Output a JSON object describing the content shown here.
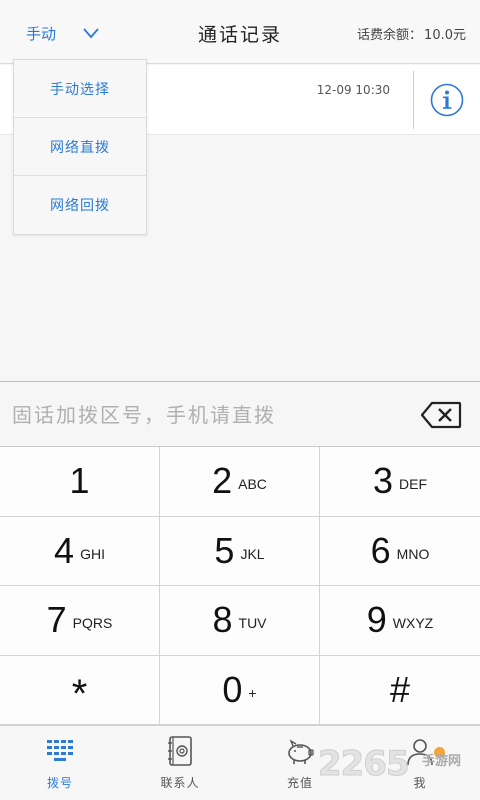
{
  "header": {
    "mode_label": "手动",
    "title": "通话记录",
    "balance_label": "话费余额：",
    "balance_value": "10.0元"
  },
  "call_log": [
    {
      "time": "12-09 10:30"
    }
  ],
  "mode_menu": {
    "options": [
      "手动选择",
      "网络直拨",
      "网络回拨"
    ]
  },
  "dialer": {
    "placeholder": "固话加拨区号，手机请直拨",
    "keys": [
      {
        "digit": "1",
        "letters": ""
      },
      {
        "digit": "2",
        "letters": "ABC"
      },
      {
        "digit": "3",
        "letters": "DEF"
      },
      {
        "digit": "4",
        "letters": "GHI"
      },
      {
        "digit": "5",
        "letters": "JKL"
      },
      {
        "digit": "6",
        "letters": "MNO"
      },
      {
        "digit": "7",
        "letters": "PQRS"
      },
      {
        "digit": "8",
        "letters": "TUV"
      },
      {
        "digit": "9",
        "letters": "WXYZ"
      },
      {
        "digit": "*",
        "letters": ""
      },
      {
        "digit": "0",
        "letters": "+"
      },
      {
        "digit": "#",
        "letters": ""
      }
    ]
  },
  "tabs": [
    {
      "label": "拨号",
      "icon": "dialpad-icon",
      "active": true
    },
    {
      "label": "联系人",
      "icon": "contacts-book-icon",
      "active": false
    },
    {
      "label": "充值",
      "icon": "piggy-bank-icon",
      "active": false
    },
    {
      "label": "我",
      "icon": "user-icon",
      "active": false
    }
  ],
  "watermark": {
    "text": "2265",
    "sub": "手游网"
  },
  "colors": {
    "accent": "#2b7bd6",
    "background": "#f6f6f6",
    "watermark_dot": "#f4a43a"
  }
}
